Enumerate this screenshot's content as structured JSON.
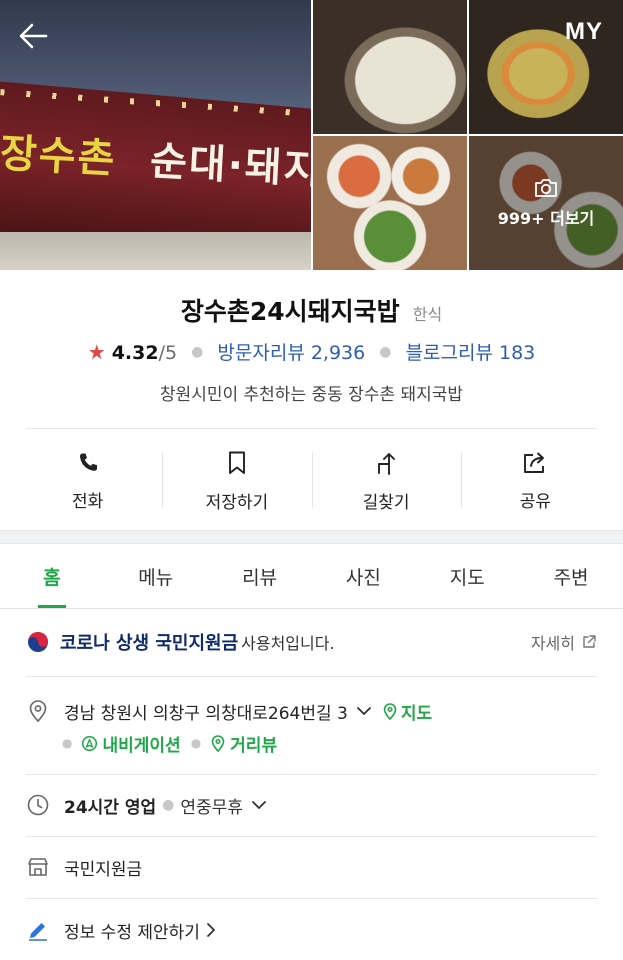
{
  "header": {
    "back_icon": "arrow-left-icon",
    "my_label": "MY"
  },
  "hero": {
    "sign_text_main": "장수촌",
    "sign_text_sub": "순대·돼지국",
    "more_photos_label": "999+ 더보기",
    "camera_icon": "camera-icon"
  },
  "place": {
    "name": "장수촌24시돼지국밥",
    "category": "한식",
    "rating": "4.32",
    "rating_max": "/5",
    "visitor_reviews": "방문자리뷰 2,936",
    "blog_reviews": "블로그리뷰 183",
    "description": "창원시민이 추천하는 중동 장수촌 돼지국밥"
  },
  "actions": [
    {
      "label": "전화",
      "icon": "phone-icon"
    },
    {
      "label": "저장하기",
      "icon": "bookmark-icon"
    },
    {
      "label": "길찾기",
      "icon": "directions-icon"
    },
    {
      "label": "공유",
      "icon": "share-icon"
    }
  ],
  "tabs": [
    {
      "label": "홈",
      "active": true
    },
    {
      "label": "메뉴"
    },
    {
      "label": "리뷰"
    },
    {
      "label": "사진"
    },
    {
      "label": "지도"
    },
    {
      "label": "주변"
    }
  ],
  "info": {
    "corona_strong": "코로나 상생 국민지원금",
    "corona_rest": "사용처입니다.",
    "detail_label": "자세히",
    "address": "경남 창원시 의창구 의창대로264번길 3",
    "map_label": "지도",
    "navigation_label": "내비게이션",
    "street_view_label": "거리뷰",
    "hours_label": "24시간 영업",
    "hours_extra": "연중무휴",
    "support_label": "국민지원금",
    "edit_label": "정보 수정 제안하기"
  },
  "colors": {
    "accent_green": "#1fa849",
    "link_blue": "#2d5eb4",
    "star_red": "#e64545",
    "corona_navy": "#0f2a6b"
  }
}
